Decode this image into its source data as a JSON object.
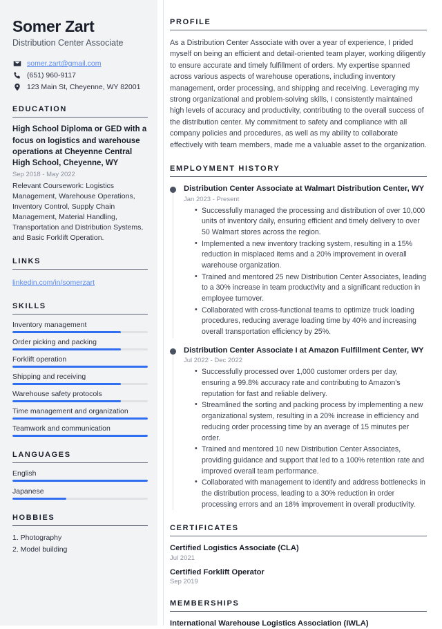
{
  "header": {
    "name": "Somer Zart",
    "job_title": "Distribution Center Associate",
    "contacts": [
      {
        "icon": "envelope-icon",
        "value": "somer.zart@gmail.com",
        "is_link": true
      },
      {
        "icon": "phone-icon",
        "value": "(651) 960-9117",
        "is_link": false
      },
      {
        "icon": "location-pin-icon",
        "value": "123 Main St, Cheyenne, WY 82001",
        "is_link": false
      }
    ]
  },
  "sidebar": {
    "education": {
      "heading": "EDUCATION",
      "items": [
        {
          "title": "High School Diploma or GED with a focus on logistics and warehouse operations at Cheyenne Central High School, Cheyenne, WY",
          "date": "Sep 2018 - May 2022",
          "description": "Relevant Coursework: Logistics Management, Warehouse Operations, Inventory Control, Supply Chain Management, Material Handling, Transportation and Distribution Systems, and Basic Forklift Operation."
        }
      ]
    },
    "links": {
      "heading": "LINKS",
      "items": [
        {
          "label": "linkedin.com/in/somerzart"
        }
      ]
    },
    "skills": {
      "heading": "SKILLS",
      "items": [
        {
          "label": "Inventory management",
          "level": 80
        },
        {
          "label": "Order picking and packing",
          "level": 80
        },
        {
          "label": "Forklift operation",
          "level": 100
        },
        {
          "label": "Shipping and receiving",
          "level": 80
        },
        {
          "label": "Warehouse safety protocols",
          "level": 80
        },
        {
          "label": "Time management and organization",
          "level": 100
        },
        {
          "label": "Teamwork and communication",
          "level": 100
        }
      ]
    },
    "languages": {
      "heading": "LANGUAGES",
      "items": [
        {
          "label": "English",
          "level": 100
        },
        {
          "label": "Japanese",
          "level": 40
        }
      ]
    },
    "hobbies": {
      "heading": "HOBBIES",
      "items": [
        {
          "label": "1. Photography"
        },
        {
          "label": "2. Model building"
        }
      ]
    }
  },
  "main": {
    "profile": {
      "heading": "PROFILE",
      "text": "As a Distribution Center Associate with over a year of experience, I prided myself on being an efficient and detail-oriented team player, working diligently to ensure accurate and timely fulfillment of orders. My expertise spanned across various aspects of warehouse operations, including inventory management, order processing, and shipping and receiving. Leveraging my strong organizational and problem-solving skills, I consistently maintained high levels of accuracy and productivity, contributing to the overall success of the distribution center. My commitment to safety and compliance with all company policies and procedures, as well as my ability to collaborate effectively with team members, made me a valuable asset to the organization."
    },
    "employment": {
      "heading": "EMPLOYMENT HISTORY",
      "jobs": [
        {
          "role": "Distribution Center Associate at Walmart Distribution Center, WY",
          "date": "Jan 2023 - Present",
          "bullets": [
            "Successfully managed the processing and distribution of over 10,000 units of inventory daily, ensuring efficient and timely delivery to over 50 Walmart stores across the region.",
            "Implemented a new inventory tracking system, resulting in a 15% reduction in misplaced items and a 20% improvement in overall warehouse organization.",
            "Trained and mentored 25 new Distribution Center Associates, leading to a 30% increase in team productivity and a significant reduction in employee turnover.",
            "Collaborated with cross-functional teams to optimize truck loading procedures, reducing average loading time by 40% and increasing overall transportation efficiency by 25%."
          ]
        },
        {
          "role": "Distribution Center Associate I at Amazon Fulfillment Center, WY",
          "date": "Jul 2022 - Dec 2022",
          "bullets": [
            "Successfully processed over 1,000 customer orders per day, ensuring a 99.8% accuracy rate and contributing to Amazon's reputation for fast and reliable delivery.",
            "Streamlined the sorting and packing process by implementing a new organizational system, resulting in a 20% increase in efficiency and reducing order processing time by an average of 15 minutes per order.",
            "Trained and mentored 10 new Distribution Center Associates, providing guidance and support that led to a 100% retention rate and improved overall team performance.",
            "Collaborated with management to identify and address bottlenecks in the distribution process, leading to a 30% reduction in order processing errors and an 18% improvement in overall productivity."
          ]
        }
      ]
    },
    "certificates": {
      "heading": "CERTIFICATES",
      "items": [
        {
          "title": "Certified Logistics Associate (CLA)",
          "date": "Jul 2021"
        },
        {
          "title": "Certified Forklift Operator",
          "date": "Sep 2019"
        }
      ]
    },
    "memberships": {
      "heading": "MEMBERSHIPS",
      "items": [
        {
          "title": "International Warehouse Logistics Association (IWLA)"
        }
      ]
    }
  },
  "colors": {
    "accent": "#2f6ef0",
    "link": "#5b8bf0",
    "heading": "#1a1f2b",
    "sidebar_bg": "#f2f3f5",
    "body_text": "#3a4150",
    "muted_text": "#8a909c"
  }
}
